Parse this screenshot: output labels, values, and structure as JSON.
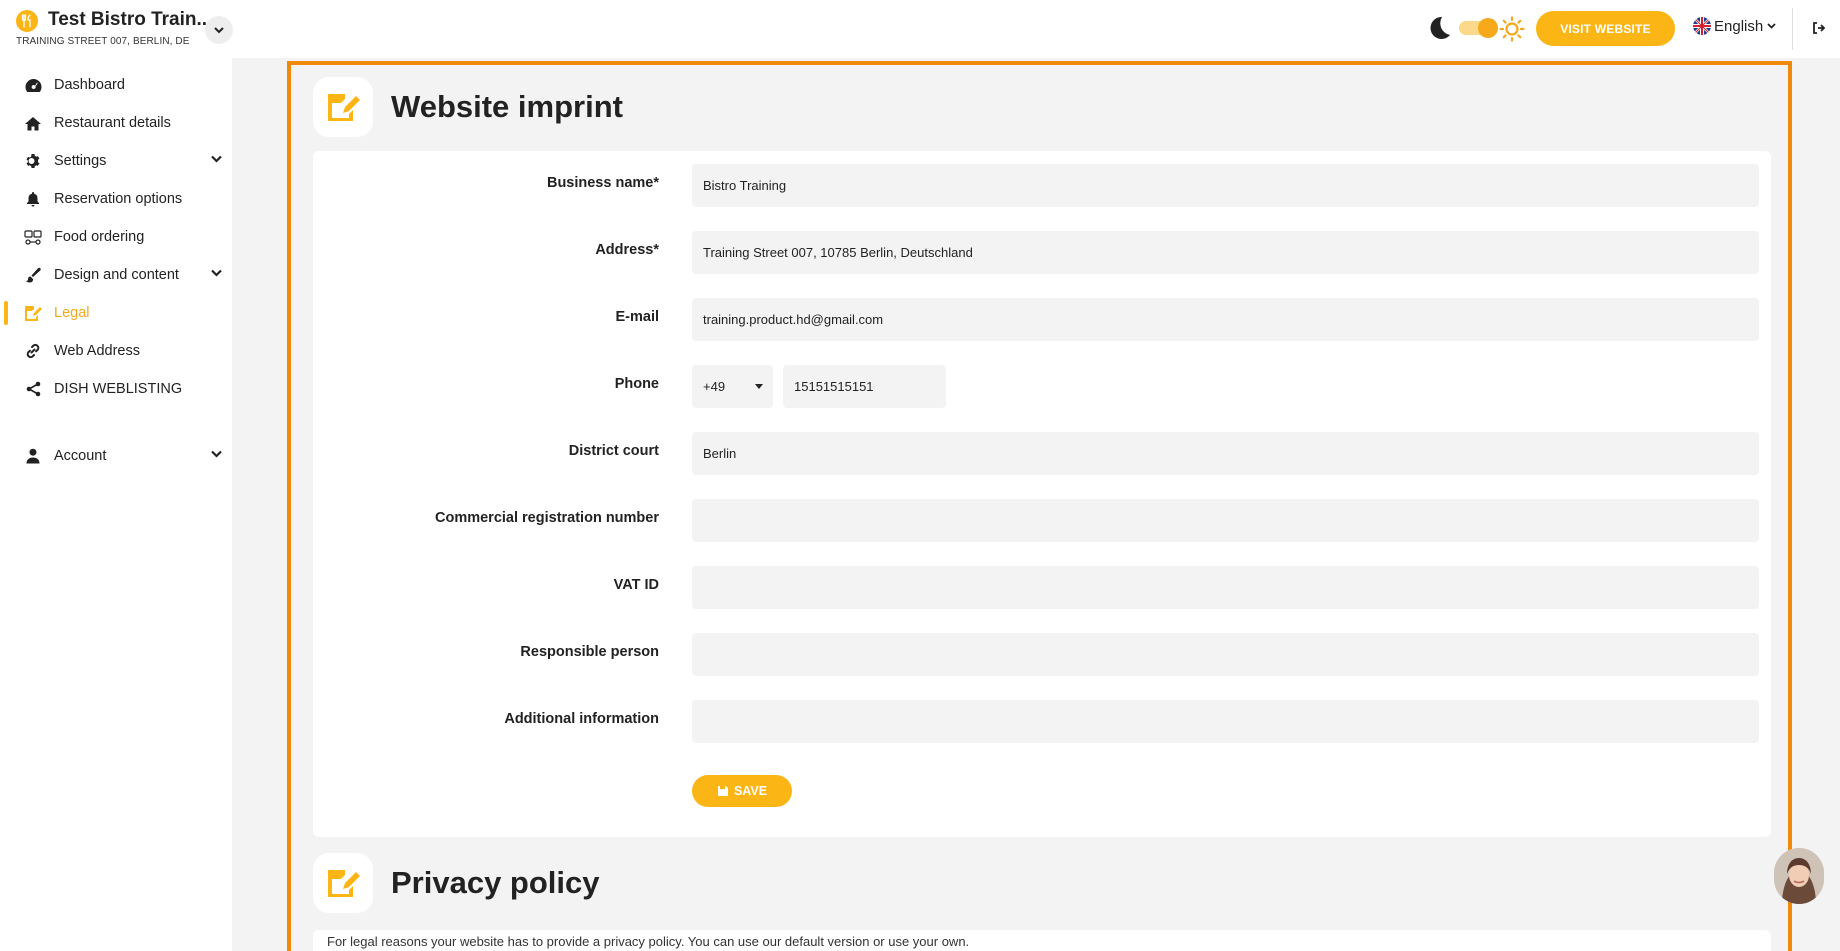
{
  "header": {
    "restaurant_name": "Test Bistro Train..",
    "restaurant_address": "TRAINING STREET 007, BERLIN, DE",
    "visit_website_label": "VISIT WEBSITE",
    "language": "English"
  },
  "sidebar": {
    "items": [
      {
        "label": "Dashboard",
        "icon": "dashboard-icon"
      },
      {
        "label": "Restaurant details",
        "icon": "home-icon"
      },
      {
        "label": "Settings",
        "icon": "gear-icon",
        "expandable": true
      },
      {
        "label": "Reservation options",
        "icon": "bell-icon"
      },
      {
        "label": "Food ordering",
        "icon": "food-ordering-icon"
      },
      {
        "label": "Design and content",
        "icon": "brush-icon",
        "expandable": true
      },
      {
        "label": "Legal",
        "icon": "legal-icon",
        "active": true
      },
      {
        "label": "Web Address",
        "icon": "link-icon"
      },
      {
        "label": "DISH WEBLISTING",
        "icon": "share-icon"
      },
      {
        "label": "Account",
        "icon": "user-icon",
        "expandable": true
      }
    ]
  },
  "imprint": {
    "title": "Website imprint",
    "fields": {
      "business_name": {
        "label": "Business name*",
        "value": "Bistro Training"
      },
      "address": {
        "label": "Address*",
        "value": "Training Street 007, 10785 Berlin, Deutschland"
      },
      "email": {
        "label": "E-mail",
        "value": "training.product.hd@gmail.com"
      },
      "phone": {
        "label": "Phone",
        "country_code": "+49",
        "number": "15151515151"
      },
      "district_court": {
        "label": "District court",
        "value": "Berlin"
      },
      "commercial_registration": {
        "label": "Commercial registration number",
        "value": ""
      },
      "vat_id": {
        "label": "VAT ID",
        "value": ""
      },
      "responsible_person": {
        "label": "Responsible person",
        "value": ""
      },
      "additional_information": {
        "label": "Additional information",
        "value": ""
      }
    },
    "save_label": "SAVE"
  },
  "privacy": {
    "title": "Privacy policy",
    "text": "For legal reasons your website has to provide a privacy policy. You can use our default version or use your own."
  },
  "colors": {
    "accent": "#fbb514",
    "frame": "#f18a0b",
    "active_text": "#f7a81b"
  }
}
